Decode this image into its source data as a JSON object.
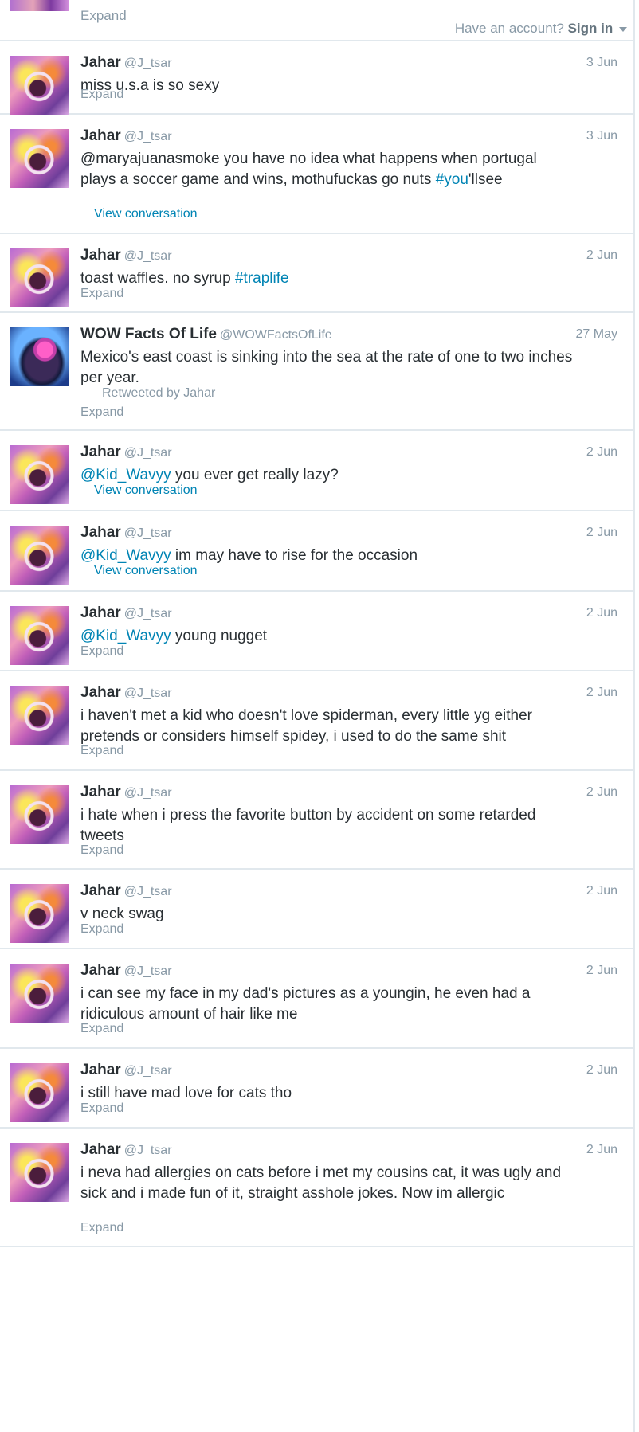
{
  "header": {
    "have_account": "Have an account?",
    "sign_in": "Sign in"
  },
  "top_stub": {
    "expand": "Expand"
  },
  "tweets": [
    {
      "name": "Jahar",
      "handle": "@J_tsar",
      "date": "3 Jun",
      "segments": [
        {
          "t": "miss u.s.a is so sexy",
          "link": false
        }
      ],
      "footer": "Expand",
      "footer_kind": "expand"
    },
    {
      "name": "Jahar",
      "handle": "@J_tsar",
      "date": "3 Jun",
      "segments": [
        {
          "t": "@maryajuanasmoke you have no idea what happens when portugal plays a soccer game and wins, mothufuckas go nuts ",
          "link": false
        },
        {
          "t": "#you",
          "link": true
        },
        {
          "t": "'llsee",
          "link": false
        }
      ],
      "footer": "View conversation",
      "footer_kind": "convo"
    },
    {
      "name": "Jahar",
      "handle": "@J_tsar",
      "date": "2 Jun",
      "segments": [
        {
          "t": "toast waffles. no syrup ",
          "link": false
        },
        {
          "t": "#traplife",
          "link": true
        }
      ],
      "footer": "Expand",
      "footer_kind": "expand"
    },
    {
      "name": "WOW Facts Of Life",
      "handle": "@WOWFactsOfLife",
      "date": "27 May",
      "segments": [
        {
          "t": "Mexico's east coast is sinking into the sea at the rate of one to two inches per year.",
          "link": false
        }
      ],
      "retweeted_by": "Retweeted by Jahar",
      "footer": "Expand",
      "footer_kind": "expand",
      "avatar": "brain"
    },
    {
      "name": "Jahar",
      "handle": "@J_tsar",
      "date": "2 Jun",
      "segments": [
        {
          "t": "@Kid_Wavyy",
          "link": true
        },
        {
          "t": " you ever get really lazy?",
          "link": false
        }
      ],
      "footer": "View conversation",
      "footer_kind": "convo"
    },
    {
      "name": "Jahar",
      "handle": "@J_tsar",
      "date": "2 Jun",
      "segments": [
        {
          "t": "@Kid_Wavyy",
          "link": true
        },
        {
          "t": " im may have to rise for the occasion",
          "link": false
        }
      ],
      "footer": "View conversation",
      "footer_kind": "convo"
    },
    {
      "name": "Jahar",
      "handle": "@J_tsar",
      "date": "2 Jun",
      "segments": [
        {
          "t": "@Kid_Wavyy",
          "link": true
        },
        {
          "t": " young nugget",
          "link": false
        }
      ],
      "footer": "Expand",
      "footer_kind": "expand"
    },
    {
      "name": "Jahar",
      "handle": "@J_tsar",
      "date": "2 Jun",
      "segments": [
        {
          "t": "i haven't met a kid who doesn't love spiderman, every little yg either pretends or considers himself spidey, i used to do the same shit",
          "link": false
        }
      ],
      "footer": "Expand",
      "footer_kind": "expand"
    },
    {
      "name": "Jahar",
      "handle": "@J_tsar",
      "date": "2 Jun",
      "segments": [
        {
          "t": "i hate when i press the favorite button by accident on some retarded tweets",
          "link": false
        }
      ],
      "footer": "Expand",
      "footer_kind": "expand"
    },
    {
      "name": "Jahar",
      "handle": "@J_tsar",
      "date": "2 Jun",
      "segments": [
        {
          "t": "v neck swag",
          "link": false
        }
      ],
      "footer": "Expand",
      "footer_kind": "expand"
    },
    {
      "name": "Jahar",
      "handle": "@J_tsar",
      "date": "2 Jun",
      "segments": [
        {
          "t": "i can see my face in my dad's pictures as a youngin, he even had a ridiculous amount of hair like me",
          "link": false
        }
      ],
      "footer": "Expand",
      "footer_kind": "expand"
    },
    {
      "name": "Jahar",
      "handle": "@J_tsar",
      "date": "2 Jun",
      "segments": [
        {
          "t": "i still have mad love for cats tho",
          "link": false
        }
      ],
      "footer": "Expand",
      "footer_kind": "expand"
    },
    {
      "name": "Jahar",
      "handle": "@J_tsar",
      "date": "2 Jun",
      "segments": [
        {
          "t": "i neva had allergies on cats before i met my cousins cat, it was ugly and sick and i made fun of it, straight asshole jokes. Now im allergic",
          "link": false
        }
      ],
      "footer": "Expand",
      "footer_kind": "expand"
    }
  ]
}
